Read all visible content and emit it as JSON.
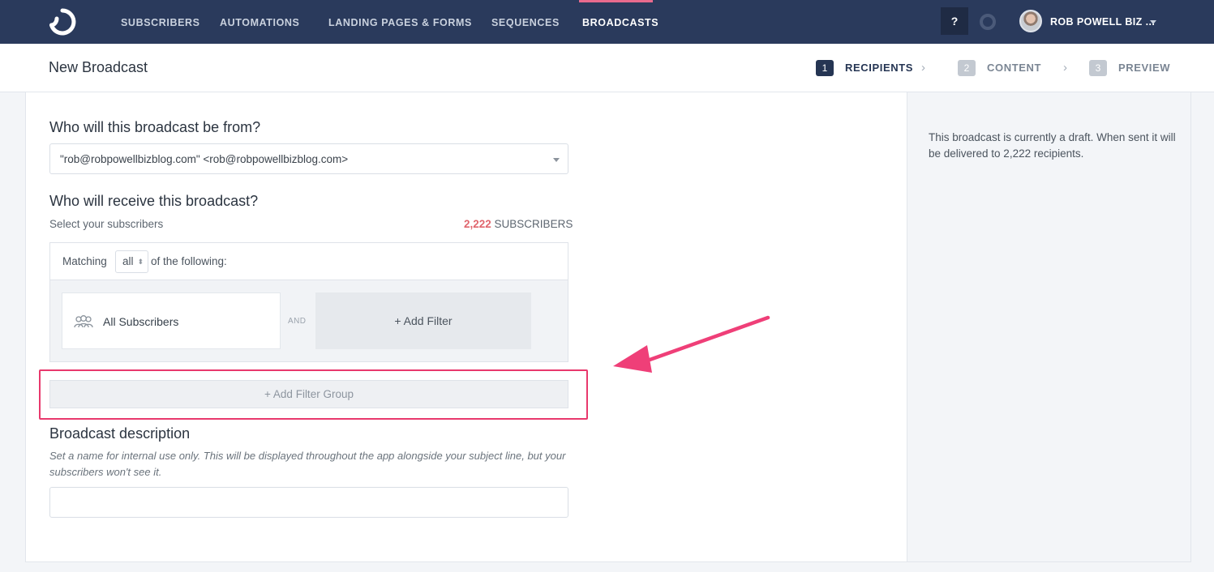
{
  "nav": {
    "items": [
      {
        "label": "SUBSCRIBERS"
      },
      {
        "label": "AUTOMATIONS"
      },
      {
        "label": "LANDING PAGES & FORMS"
      },
      {
        "label": "SEQUENCES"
      },
      {
        "label": "BROADCASTS",
        "active": true
      }
    ],
    "help_label": "?",
    "user_name": "ROB POWELL BIZ ...",
    "active_color": "#e86a8d",
    "background_color": "#2a3a5c"
  },
  "header": {
    "title": "New Broadcast",
    "steps": [
      {
        "number": "1",
        "label": "RECIPIENTS",
        "active": true
      },
      {
        "number": "2",
        "label": "CONTENT",
        "active": false
      },
      {
        "number": "3",
        "label": "PREVIEW",
        "active": false
      }
    ]
  },
  "form": {
    "from_heading": "Who will this broadcast be from?",
    "from_value": "\"rob@robpowellbizblog.com\" <rob@robpowellbizblog.com>",
    "receive_heading": "Who will receive this broadcast?",
    "select_subscribers_label": "Select your subscribers",
    "subscriber_count": "2,222",
    "subscriber_count_suffix": " SUBSCRIBERS",
    "matching_prefix": "Matching",
    "matching_value": "all",
    "matching_suffix": "of the following:",
    "segment_label": "All Subscribers",
    "and_label": "AND",
    "add_filter_label": "+ Add Filter",
    "add_filter_group_label": "+ Add Filter Group",
    "description_heading": "Broadcast description",
    "description_help": "Set a name for internal use only. This will be displayed throughout the app alongside your subject line, but your subscribers won't see it.",
    "description_value": ""
  },
  "sidebar": {
    "status_text": "This broadcast is currently a draft. When sent it will be delivered to 2,222 recipients."
  },
  "annotation": {
    "highlight_color": "#e8396d",
    "arrow_color": "#ef3f78"
  }
}
